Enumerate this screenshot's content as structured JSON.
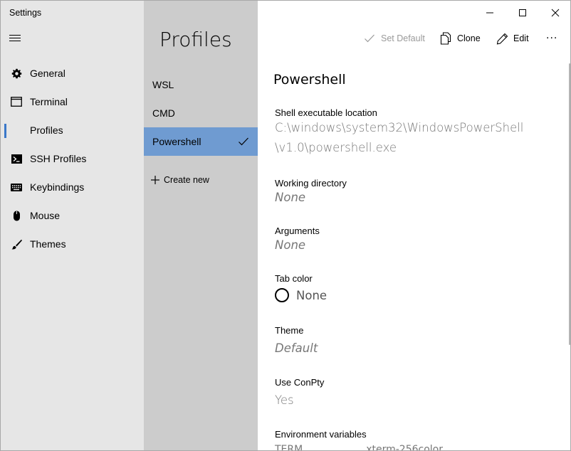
{
  "window": {
    "title": "Settings"
  },
  "nav": {
    "items": [
      {
        "label": "General",
        "icon": "gear-icon",
        "selected": false
      },
      {
        "label": "Terminal",
        "icon": "terminal-window-icon",
        "selected": false
      },
      {
        "label": "Profiles",
        "icon": "",
        "selected": true
      },
      {
        "label": "SSH Profiles",
        "icon": "console-prompt-icon",
        "selected": false
      },
      {
        "label": "Keybindings",
        "icon": "keyboard-icon",
        "selected": false
      },
      {
        "label": "Mouse",
        "icon": "mouse-icon",
        "selected": false
      },
      {
        "label": "Themes",
        "icon": "brush-icon",
        "selected": false
      }
    ]
  },
  "profiles": {
    "title": "Profiles",
    "items": [
      {
        "label": "WSL",
        "selected": false
      },
      {
        "label": "CMD",
        "selected": false
      },
      {
        "label": "Powershell",
        "selected": true
      }
    ],
    "create_new": "Create new"
  },
  "toolbar": {
    "set_default": "Set Default",
    "clone": "Clone",
    "edit": "Edit",
    "more": "..."
  },
  "detail": {
    "title": "Powershell",
    "shell_label": "Shell executable location",
    "shell_value_line1": "C:\\windows\\system32\\WindowsPowerShell",
    "shell_value_line2": "\\v1.0\\powershell.exe",
    "workdir_label": "Working directory",
    "workdir_value": "None",
    "args_label": "Arguments",
    "args_value": "None",
    "tabcolor_label": "Tab color",
    "tabcolor_value": "None",
    "theme_label": "Theme",
    "theme_value": "Default",
    "conpty_label": "Use ConPty",
    "conpty_value": "Yes",
    "env_label": "Environment variables",
    "env_partial": "TERM                    xterm-256color"
  },
  "colors": {
    "nav_bg": "#e6e6e6",
    "profiles_bg": "#cccccc",
    "selected_profile": "#6f9bd1",
    "accent": "#3a78c9"
  }
}
